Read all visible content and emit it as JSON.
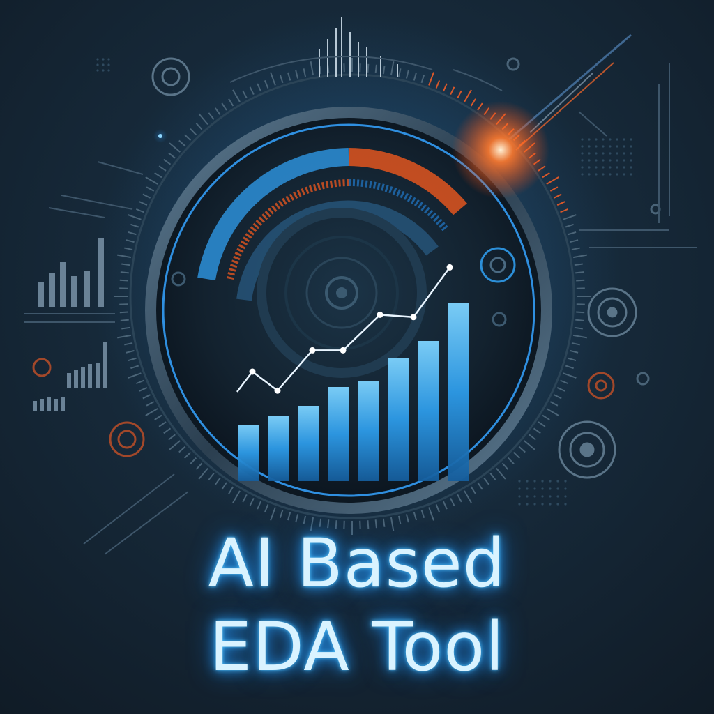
{
  "title": {
    "line1": "AI Based",
    "line2": "EDA Tool"
  },
  "colors": {
    "background": "#14222f",
    "accent_blue": "#2aa0ff",
    "accent_orange": "#ff5a1f",
    "title_text": "#d9f3ff"
  },
  "emblem": {
    "bars": [
      0.27,
      0.31,
      0.36,
      0.45,
      0.48,
      0.59,
      0.67,
      0.85
    ],
    "trend_line": [
      0.55,
      0.47,
      0.64,
      0.64,
      0.79,
      0.78,
      0.99
    ]
  },
  "icons": [
    "dial-gauge-icon",
    "bar-chart-icon",
    "trend-line-icon",
    "target-circle-icon",
    "mini-bar-chart-icon"
  ]
}
